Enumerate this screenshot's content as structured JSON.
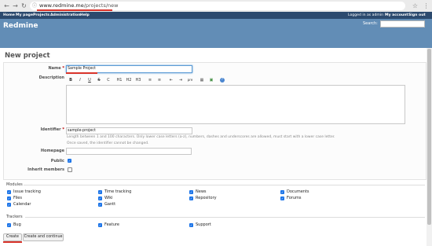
{
  "browser": {
    "url_host": "www.redmine.me",
    "url_path": "/projects/new"
  },
  "topmenu": {
    "left": [
      "Home",
      "My page",
      "Projects",
      "Administration",
      "Help"
    ],
    "logged_in": "Logged in as admin",
    "right": [
      "My account",
      "Sign out"
    ]
  },
  "header": {
    "title": "Redmine",
    "search_label": "Search:"
  },
  "page": {
    "title": "New project"
  },
  "form": {
    "name_label": "Name",
    "name_value": "Sample Project",
    "description_label": "Description",
    "toolbar": [
      "B",
      "I",
      "U",
      "S",
      "C",
      "H1",
      "H2",
      "H3",
      "≡",
      "≡",
      "⇤",
      "⇥",
      "pre",
      "▦",
      "▣",
      "?"
    ],
    "identifier_label": "Identifier",
    "identifier_value": "sample-project",
    "identifier_help1": "Length between 1 and 100 characters. Only lower case letters (a-z), numbers, dashes and underscores are allowed, must start with a lower case letter.",
    "identifier_help2": "Once saved, the identifier cannot be changed.",
    "homepage_label": "Homepage",
    "public_label": "Public",
    "public_checked": true,
    "inherit_label": "Inherit members",
    "inherit_checked": false,
    "required_mark": "*"
  },
  "modules": {
    "title": "Modules",
    "items": [
      {
        "label": "Issue tracking",
        "checked": true
      },
      {
        "label": "Time tracking",
        "checked": true
      },
      {
        "label": "News",
        "checked": true
      },
      {
        "label": "Documents",
        "checked": true
      },
      {
        "label": "Files",
        "checked": true
      },
      {
        "label": "Wiki",
        "checked": true
      },
      {
        "label": "Repository",
        "checked": true
      },
      {
        "label": "Forums",
        "checked": true
      },
      {
        "label": "Calendar",
        "checked": true
      },
      {
        "label": "Gantt",
        "checked": true
      }
    ]
  },
  "trackers": {
    "title": "Trackers",
    "items": [
      {
        "label": "Bug",
        "checked": true
      },
      {
        "label": "Feature",
        "checked": true
      },
      {
        "label": "Support",
        "checked": true
      }
    ]
  },
  "buttons": {
    "create": "Create",
    "create_continue": "Create and continue"
  },
  "colors": {
    "header_bg": "#628db6",
    "topmenu_bg": "#2c4a6e",
    "annotation": "#d9342b",
    "checkbox": "#1a73e8"
  }
}
